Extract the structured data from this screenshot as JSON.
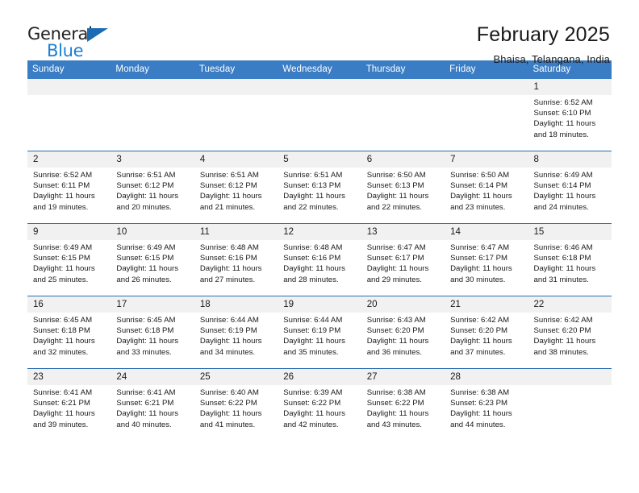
{
  "brand": {
    "name_part1": "General",
    "name_part2": "Blue",
    "accent_color": "#1b7fd4",
    "triangle_color": "#1b6cb5"
  },
  "header": {
    "title": "February 2025",
    "subtitle": "Bhaisa, Telangana, India"
  },
  "calendar": {
    "header_color": "#3b7dc4",
    "daynum_band_color": "#f1f1f1",
    "row_divider_color": "#2a6db3",
    "weekday_headers": [
      "Sunday",
      "Monday",
      "Tuesday",
      "Wednesday",
      "Thursday",
      "Friday",
      "Saturday"
    ],
    "labels": {
      "sunrise": "Sunrise:",
      "sunset": "Sunset:",
      "daylight": "Daylight:"
    },
    "weeks": [
      [
        {
          "day": ""
        },
        {
          "day": ""
        },
        {
          "day": ""
        },
        {
          "day": ""
        },
        {
          "day": ""
        },
        {
          "day": ""
        },
        {
          "day": "1",
          "sunrise": "Sunrise: 6:52 AM",
          "sunset": "Sunset: 6:10 PM",
          "daylight": "Daylight: 11 hours and 18 minutes."
        }
      ],
      [
        {
          "day": "2",
          "sunrise": "Sunrise: 6:52 AM",
          "sunset": "Sunset: 6:11 PM",
          "daylight": "Daylight: 11 hours and 19 minutes."
        },
        {
          "day": "3",
          "sunrise": "Sunrise: 6:51 AM",
          "sunset": "Sunset: 6:12 PM",
          "daylight": "Daylight: 11 hours and 20 minutes."
        },
        {
          "day": "4",
          "sunrise": "Sunrise: 6:51 AM",
          "sunset": "Sunset: 6:12 PM",
          "daylight": "Daylight: 11 hours and 21 minutes."
        },
        {
          "day": "5",
          "sunrise": "Sunrise: 6:51 AM",
          "sunset": "Sunset: 6:13 PM",
          "daylight": "Daylight: 11 hours and 22 minutes."
        },
        {
          "day": "6",
          "sunrise": "Sunrise: 6:50 AM",
          "sunset": "Sunset: 6:13 PM",
          "daylight": "Daylight: 11 hours and 22 minutes."
        },
        {
          "day": "7",
          "sunrise": "Sunrise: 6:50 AM",
          "sunset": "Sunset: 6:14 PM",
          "daylight": "Daylight: 11 hours and 23 minutes."
        },
        {
          "day": "8",
          "sunrise": "Sunrise: 6:49 AM",
          "sunset": "Sunset: 6:14 PM",
          "daylight": "Daylight: 11 hours and 24 minutes."
        }
      ],
      [
        {
          "day": "9",
          "sunrise": "Sunrise: 6:49 AM",
          "sunset": "Sunset: 6:15 PM",
          "daylight": "Daylight: 11 hours and 25 minutes."
        },
        {
          "day": "10",
          "sunrise": "Sunrise: 6:49 AM",
          "sunset": "Sunset: 6:15 PM",
          "daylight": "Daylight: 11 hours and 26 minutes."
        },
        {
          "day": "11",
          "sunrise": "Sunrise: 6:48 AM",
          "sunset": "Sunset: 6:16 PM",
          "daylight": "Daylight: 11 hours and 27 minutes."
        },
        {
          "day": "12",
          "sunrise": "Sunrise: 6:48 AM",
          "sunset": "Sunset: 6:16 PM",
          "daylight": "Daylight: 11 hours and 28 minutes."
        },
        {
          "day": "13",
          "sunrise": "Sunrise: 6:47 AM",
          "sunset": "Sunset: 6:17 PM",
          "daylight": "Daylight: 11 hours and 29 minutes."
        },
        {
          "day": "14",
          "sunrise": "Sunrise: 6:47 AM",
          "sunset": "Sunset: 6:17 PM",
          "daylight": "Daylight: 11 hours and 30 minutes."
        },
        {
          "day": "15",
          "sunrise": "Sunrise: 6:46 AM",
          "sunset": "Sunset: 6:18 PM",
          "daylight": "Daylight: 11 hours and 31 minutes."
        }
      ],
      [
        {
          "day": "16",
          "sunrise": "Sunrise: 6:45 AM",
          "sunset": "Sunset: 6:18 PM",
          "daylight": "Daylight: 11 hours and 32 minutes."
        },
        {
          "day": "17",
          "sunrise": "Sunrise: 6:45 AM",
          "sunset": "Sunset: 6:18 PM",
          "daylight": "Daylight: 11 hours and 33 minutes."
        },
        {
          "day": "18",
          "sunrise": "Sunrise: 6:44 AM",
          "sunset": "Sunset: 6:19 PM",
          "daylight": "Daylight: 11 hours and 34 minutes."
        },
        {
          "day": "19",
          "sunrise": "Sunrise: 6:44 AM",
          "sunset": "Sunset: 6:19 PM",
          "daylight": "Daylight: 11 hours and 35 minutes."
        },
        {
          "day": "20",
          "sunrise": "Sunrise: 6:43 AM",
          "sunset": "Sunset: 6:20 PM",
          "daylight": "Daylight: 11 hours and 36 minutes."
        },
        {
          "day": "21",
          "sunrise": "Sunrise: 6:42 AM",
          "sunset": "Sunset: 6:20 PM",
          "daylight": "Daylight: 11 hours and 37 minutes."
        },
        {
          "day": "22",
          "sunrise": "Sunrise: 6:42 AM",
          "sunset": "Sunset: 6:20 PM",
          "daylight": "Daylight: 11 hours and 38 minutes."
        }
      ],
      [
        {
          "day": "23",
          "sunrise": "Sunrise: 6:41 AM",
          "sunset": "Sunset: 6:21 PM",
          "daylight": "Daylight: 11 hours and 39 minutes."
        },
        {
          "day": "24",
          "sunrise": "Sunrise: 6:41 AM",
          "sunset": "Sunset: 6:21 PM",
          "daylight": "Daylight: 11 hours and 40 minutes."
        },
        {
          "day": "25",
          "sunrise": "Sunrise: 6:40 AM",
          "sunset": "Sunset: 6:22 PM",
          "daylight": "Daylight: 11 hours and 41 minutes."
        },
        {
          "day": "26",
          "sunrise": "Sunrise: 6:39 AM",
          "sunset": "Sunset: 6:22 PM",
          "daylight": "Daylight: 11 hours and 42 minutes."
        },
        {
          "day": "27",
          "sunrise": "Sunrise: 6:38 AM",
          "sunset": "Sunset: 6:22 PM",
          "daylight": "Daylight: 11 hours and 43 minutes."
        },
        {
          "day": "28",
          "sunrise": "Sunrise: 6:38 AM",
          "sunset": "Sunset: 6:23 PM",
          "daylight": "Daylight: 11 hours and 44 minutes."
        },
        {
          "day": ""
        }
      ]
    ]
  }
}
